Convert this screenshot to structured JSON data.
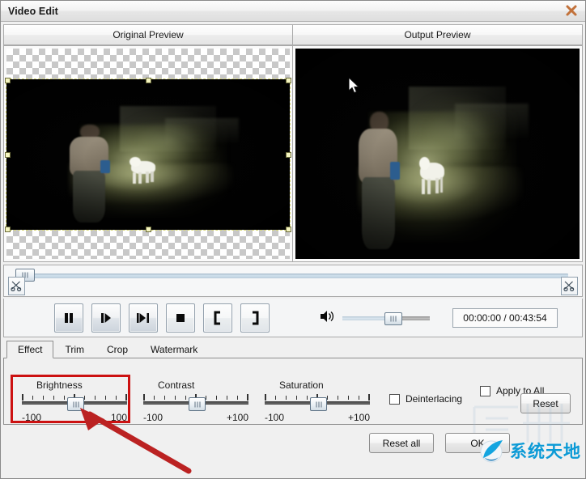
{
  "window": {
    "title": "Video Edit",
    "close_icon": "close-x-icon"
  },
  "previews": {
    "original_label": "Original Preview",
    "output_label": "Output Preview"
  },
  "timeline": {
    "trim_start_icon": "scissors-icon",
    "trim_end_icon": "scissors-icon",
    "position_percent": 0
  },
  "transport": {
    "buttons": [
      {
        "name": "pause-button",
        "icon": "pause-icon"
      },
      {
        "name": "play-next-button",
        "icon": "step-forward-icon"
      },
      {
        "name": "next-frame-button",
        "icon": "frame-forward-icon"
      },
      {
        "name": "stop-button",
        "icon": "stop-icon"
      },
      {
        "name": "mark-in-button",
        "icon": "bracket-left-icon"
      },
      {
        "name": "mark-out-button",
        "icon": "bracket-right-icon"
      }
    ],
    "volume_icon": "speaker-icon",
    "volume_percent": 50,
    "time_display": "00:00:00 / 00:43:54"
  },
  "tabs": [
    {
      "label": "Effect",
      "active": true
    },
    {
      "label": "Trim",
      "active": false
    },
    {
      "label": "Crop",
      "active": false
    },
    {
      "label": "Watermark",
      "active": false
    }
  ],
  "effect": {
    "sliders": [
      {
        "label": "Brightness",
        "min_label": "-100",
        "max_label": "100",
        "value": 0,
        "highlighted": true
      },
      {
        "label": "Contrast",
        "min_label": "-100",
        "max_label": "+100",
        "value": 0,
        "highlighted": false
      },
      {
        "label": "Saturation",
        "min_label": "-100",
        "max_label": "+100",
        "value": 0,
        "highlighted": false
      }
    ],
    "deinterlacing": {
      "label": "Deinterlacing",
      "checked": false
    },
    "apply_to_all": {
      "label": "Apply to All",
      "checked": false
    },
    "reset_label": "Reset"
  },
  "footer": {
    "reset_all_label": "Reset all",
    "ok_label": "OK"
  },
  "watermark": {
    "text": "系统天地",
    "logo_icon": "globe-swoosh-icon",
    "accent_color": "#0b9ad6"
  },
  "annotation": {
    "highlight_color": "#cc1111",
    "arrow_color": "#bb2222",
    "target": "Brightness"
  }
}
